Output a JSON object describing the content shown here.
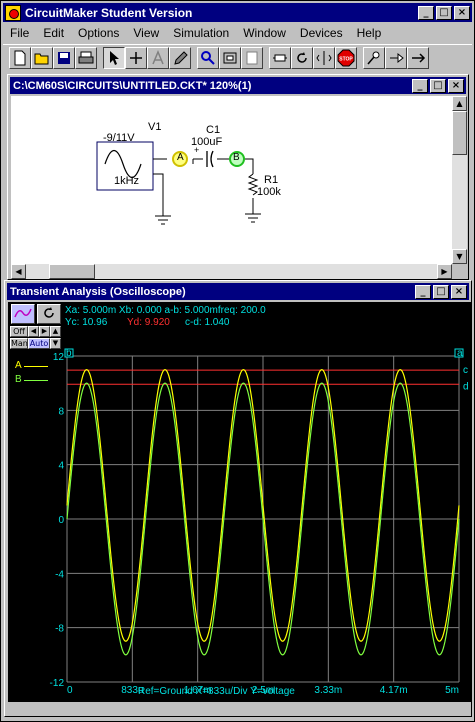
{
  "app": {
    "title": "CircuitMaker Student Version"
  },
  "menu": [
    "File",
    "Edit",
    "Options",
    "View",
    "Simulation",
    "Window",
    "Devices",
    "Help"
  ],
  "toolbar": {
    "stop_label": "STOP",
    "buttons": [
      "new-file",
      "open-file",
      "save-file",
      "print",
      "arrow-tool",
      "wire-tool",
      "text-tool",
      "probe-tool",
      "zoom-tool",
      "macro-tool",
      "rotate-tool",
      "mirror-tool",
      "stop",
      "digital-probe",
      "analog-probe",
      "run"
    ]
  },
  "schematic_window": {
    "title": "C:\\CM60S\\CIRCUITS\\UNTITLED.CKT* 120%(1)",
    "components": {
      "v1_name": "V1",
      "v1_value": "-9/11V",
      "v1_freq": "1kHz",
      "c1_name": "C1",
      "c1_value": "100uF",
      "r1_name": "R1",
      "r1_value": "100k",
      "probe_a": "A",
      "probe_b": "B",
      "plus_sign": "+"
    }
  },
  "scope_window": {
    "title": "Transient Analysis (Oscilloscope)",
    "readout_line1": "Xa: 5.000m Xb: 0.000   a-b: 5.000mfreq: 200.0",
    "readout_yc": "Yc: 10.96",
    "readout_yd": "Yd: 9.920",
    "readout_cd": "c-d: 1.040",
    "ctrl_off": "Off",
    "ctrl_man": "Man",
    "ctrl_auto": "Auto",
    "legend": [
      {
        "name": "A",
        "color": "#ffff00"
      },
      {
        "name": "B",
        "color": "#80ff40"
      }
    ],
    "cursor_a_label": "a",
    "cursor_b_label": "b",
    "cursor_c_label": "c",
    "cursor_d_label": "d",
    "footer": "Ref=Ground  X=833u/Div Y=voltage"
  },
  "chart_data": {
    "type": "line",
    "x_ticks": [
      "0",
      "833u",
      "1.67m",
      "2.5m",
      "3.33m",
      "4.17m",
      "5m"
    ],
    "y_ticks": [
      "12",
      "8",
      "4",
      "0",
      "-4",
      "-8",
      "-12"
    ],
    "xlim": [
      0,
      0.005
    ],
    "ylim": [
      -12,
      12
    ],
    "grid": true,
    "series": [
      {
        "name": "A",
        "color": "#ffff00",
        "offset": 1,
        "amplitude": 10,
        "freq": 1000
      },
      {
        "name": "B",
        "color": "#80ff40",
        "offset": 0,
        "amplitude": 10,
        "freq": 1000
      }
    ],
    "cursor_c": 10.96,
    "cursor_d": 9.92,
    "cursor_color": "#ff3030"
  }
}
